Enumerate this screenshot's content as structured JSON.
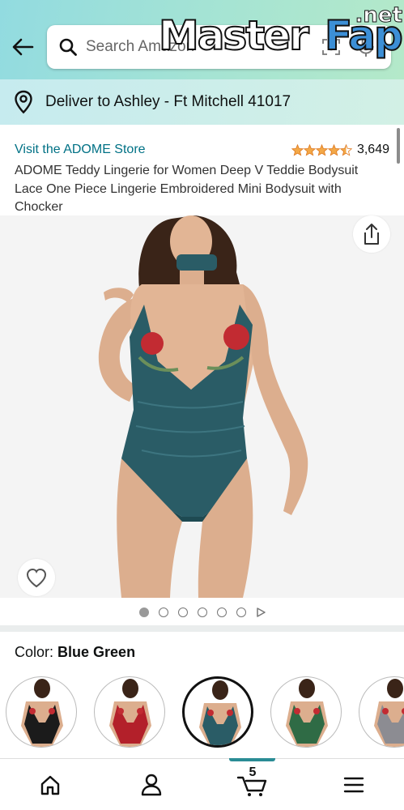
{
  "header": {
    "search_placeholder": "Search Amazon",
    "watermark": {
      "main": "Master",
      "accent": "Fap",
      "suffix": ".net"
    }
  },
  "delivery": {
    "text": "Deliver to Ashley - Ft Mitchell 41017"
  },
  "product": {
    "store_link": "Visit the ADOME Store",
    "rating_stars": 4.5,
    "rating_count": "3,649",
    "title": "ADOME Teddy Lingerie for Women Deep V Teddie Bodysuit Lace One Piece Lingerie Embroidered Mini Bodysuit with Chocker"
  },
  "gallery": {
    "image_count": 6,
    "active_index": 0,
    "has_video": true
  },
  "color": {
    "label": "Color:",
    "selected": "Blue Green",
    "swatch_colors": [
      "#1b1b1b",
      "#b3202a",
      "#2a5c66",
      "#2f6b45",
      "#8c8c92"
    ]
  },
  "bottom_nav": {
    "cart_count": "5"
  },
  "colors": {
    "link": "#007185",
    "star": "#f3a847",
    "accent": "#2a8c95",
    "product_teal": "#2a5c66",
    "rose": "#c22b32"
  }
}
